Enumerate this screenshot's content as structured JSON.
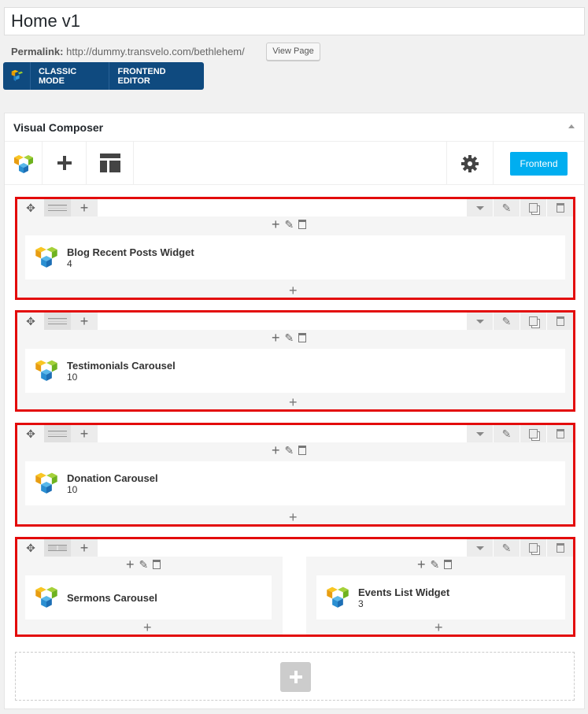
{
  "post": {
    "title": "Home v1"
  },
  "permalink": {
    "label": "Permalink:",
    "url": "http://dummy.transvelo.com/bethlehem/",
    "view_button": "View Page"
  },
  "mode_bar": {
    "classic": "CLASSIC MODE",
    "frontend_editor": "FRONTEND EDITOR"
  },
  "panel": {
    "title": "Visual Composer",
    "frontend_button": "Frontend"
  },
  "rows": [
    {
      "columns": [
        {
          "element": {
            "title": "Blog Recent Posts Widget",
            "sub": "4"
          }
        }
      ]
    },
    {
      "columns": [
        {
          "element": {
            "title": "Testimonials Carousel",
            "sub": "10"
          }
        }
      ]
    },
    {
      "columns": [
        {
          "element": {
            "title": "Donation Carousel",
            "sub": "10"
          }
        }
      ]
    },
    {
      "columns": [
        {
          "element": {
            "title": "Sermons Carousel",
            "sub": ""
          }
        },
        {
          "element": {
            "title": "Events List Widget",
            "sub": "3"
          }
        }
      ]
    }
  ],
  "colors": {
    "brand_blue": "#0f4a7f",
    "accent": "#00aef0",
    "highlight_border": "#e30b0b"
  }
}
